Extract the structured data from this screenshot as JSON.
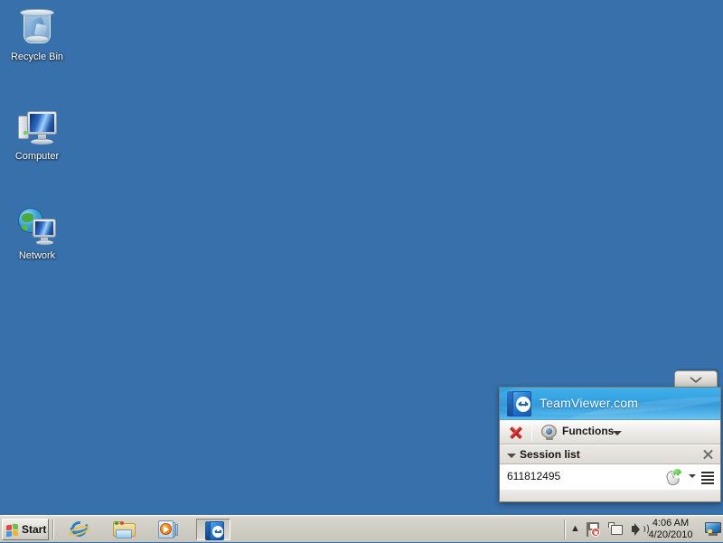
{
  "desktop": {
    "background_color": "#3870ab",
    "icons": [
      {
        "label": "Recycle Bin",
        "icon": "recycle-bin-icon"
      },
      {
        "label": "Computer",
        "icon": "computer-icon"
      },
      {
        "label": "Network",
        "icon": "network-icon"
      }
    ]
  },
  "teamviewer_panel": {
    "collapse_tab_icon": "chevron-down-icon",
    "title": "TeamViewer.com",
    "logo_icon": "teamviewer-logo-icon",
    "toolbar": {
      "close_icon": "red-x-icon",
      "functions_icon": "webcam-icon",
      "functions_label": "Functions",
      "functions_caret_icon": "caret-down-icon"
    },
    "session_section": {
      "collapse_icon": "triangle-down-icon",
      "title": "Session list",
      "close_icon": "close-x-icon"
    },
    "sessions": [
      {
        "id": "611812495",
        "status_icon": "mouse-control-granted-icon",
        "caret_icon": "caret-down-icon",
        "menu_icon": "list-menu-icon"
      }
    ]
  },
  "taskbar": {
    "start_label": "Start",
    "start_icon": "windows-flag-icon",
    "quick_launch": [
      {
        "name": "internet-explorer",
        "icon": "internet-explorer-icon",
        "active": false
      },
      {
        "name": "windows-explorer",
        "icon": "folder-icon",
        "active": false
      },
      {
        "name": "windows-media-player",
        "icon": "media-player-icon",
        "active": false
      },
      {
        "name": "teamviewer",
        "icon": "teamviewer-icon",
        "active": true
      }
    ],
    "tray": {
      "expand_icon": "chevron-up-icon",
      "icons": [
        {
          "name": "action-center",
          "icon": "flag-alert-icon"
        },
        {
          "name": "network",
          "icon": "network-monitor-icon"
        },
        {
          "name": "volume",
          "icon": "speaker-icon"
        }
      ],
      "clock_time": "4:06 AM",
      "clock_date": "4/20/2010",
      "show_desktop_icon": "show-desktop-icon"
    }
  }
}
